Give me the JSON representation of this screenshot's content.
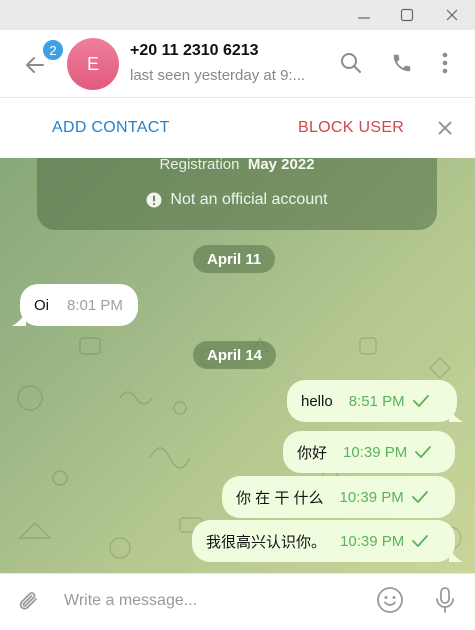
{
  "window": {
    "controls": [
      "minimize-icon",
      "maximize-icon",
      "close-icon"
    ]
  },
  "header": {
    "unread_count": "2",
    "avatar_initial": "E",
    "avatar_color": "#e86a8c",
    "contact_name": "+20 11 2310 6213",
    "status": "last seen yesterday at 9:..."
  },
  "actionbar": {
    "add_contact": "ADD CONTACT",
    "block_user": "BLOCK USER"
  },
  "chat": {
    "info_card": {
      "registration_label": "Registration",
      "registration_value": "May 2022",
      "official_note": "Not an official account"
    },
    "dates": [
      "April 11",
      "April 14"
    ],
    "messages": [
      {
        "direction": "in",
        "text": "Oi",
        "time": "8:01 PM"
      },
      {
        "direction": "out",
        "text": "hello",
        "time": "8:51 PM",
        "status": "read"
      },
      {
        "direction": "out",
        "text": "你好",
        "time": "10:39 PM",
        "status": "read"
      },
      {
        "direction": "out",
        "text": "你 在 干 什么",
        "time": "10:39 PM",
        "status": "read"
      },
      {
        "direction": "out",
        "text": "我很高兴认识你。",
        "time": "10:39 PM",
        "status": "read"
      }
    ]
  },
  "composer": {
    "placeholder": "Write a message..."
  },
  "colors": {
    "accent": "#2481cc",
    "danger": "#d1474a",
    "outgoing_bubble": "#effdde",
    "check": "#5bb25a"
  }
}
